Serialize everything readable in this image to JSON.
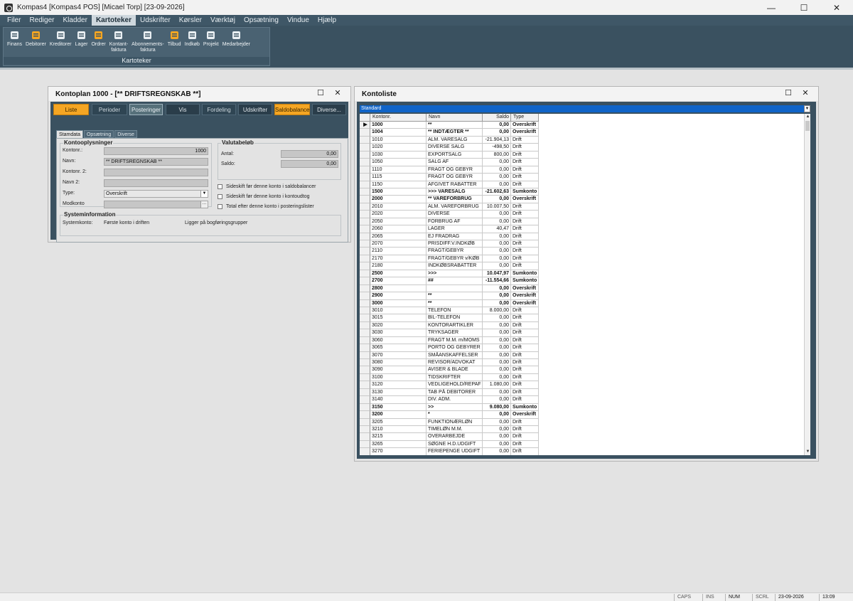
{
  "titlebar": {
    "title": "Kompas4  [Kompas4 POS]  [Micael Torp]  [23-09-2026]",
    "min": "—",
    "max": "☐",
    "close": "✕"
  },
  "menu": [
    "Filer",
    "Rediger",
    "Kladder",
    "Kartoteker",
    "Udskrifter",
    "Kørsler",
    "Værktøj",
    "Opsætning",
    "Vindue",
    "Hjælp"
  ],
  "ribbon": {
    "group_label": "Kartoteker",
    "items": [
      {
        "label": "Finans",
        "icon": "books-icon"
      },
      {
        "label": "Debitorer",
        "icon": "customer-icon"
      },
      {
        "label": "Kreditorer",
        "icon": "person-icon"
      },
      {
        "label": "Lager",
        "icon": "warehouse-icon"
      },
      {
        "label": "Ordrer",
        "icon": "money-bag-icon"
      },
      {
        "label": "Kontant-\nfaktura",
        "icon": "cash-register-icon"
      },
      {
        "label": "Abonnements-\nfaktura",
        "icon": "refresh-icon"
      },
      {
        "label": "Tilbud",
        "icon": "edit-doc-icon"
      },
      {
        "label": "Indkøb",
        "icon": "purchase-icon"
      },
      {
        "label": "Projekt",
        "icon": "project-icon"
      },
      {
        "label": "Medarbejder",
        "icon": "id-card-icon"
      }
    ]
  },
  "kontoplan": {
    "title": "Kontoplan  1000 - [** DRIFTSREGNSKAB **]",
    "buttons": [
      "Liste",
      "Perioder",
      "Posteringer",
      "Vis",
      "Fordeling",
      "Udskrifter",
      "Saldobalance",
      "Diverse..."
    ],
    "tabs": [
      "Stamdata",
      "Opsætning",
      "Diverse"
    ],
    "kontooplysninger": {
      "title": "Kontooplysninger",
      "kontonr_label": "Kontonr.:",
      "kontonr": "1000",
      "navn_label": "Navn:",
      "navn": "** DRIFTSREGNSKAB **",
      "kontonr2_label": "Kontonr. 2:",
      "navn2_label": "Navn 2:",
      "type_label": "Type:",
      "type": "Overskrift",
      "modkonto_label": "Modkonto"
    },
    "valuta": {
      "title": "Valutabeløb",
      "antal_label": "Antal:",
      "antal": "0,00",
      "saldo_label": "Saldo:",
      "saldo": "0,00"
    },
    "checks": [
      "Sideskift før denne konto i saldobalancer",
      "Sideskift før denne konto i kontoudtog",
      "Total efter denne konto i posteringslister"
    ],
    "system": {
      "title": "Systeminformation",
      "label": "Systemkonto:",
      "value": "Første konto i driften",
      "note": "Ligger på bogføringsgrupper"
    }
  },
  "kontoliste": {
    "title": "Kontoliste",
    "filter": "Standard",
    "headers": [
      "Kontonr.",
      "Navn",
      "Saldo",
      "Type"
    ],
    "rows": [
      {
        "k": "1000",
        "n": "**",
        "s": "0,00",
        "t": "Overskrift",
        "b": true,
        "sel": true
      },
      {
        "k": "1004",
        "n": "** INDTÆGTER **",
        "s": "0,00",
        "t": "Overskrift",
        "b": true
      },
      {
        "k": "1010",
        "n": "ALM. VARESALG",
        "s": "-21.904,13",
        "t": "Drift"
      },
      {
        "k": "1020",
        "n": "DIVERSE SALG",
        "s": "-498,50",
        "t": "Drift"
      },
      {
        "k": "1030",
        "n": "EXPORTSALG",
        "s": "800,00",
        "t": "Drift"
      },
      {
        "k": "1050",
        "n": "SALG AF",
        "s": "0,00",
        "t": "Drift"
      },
      {
        "k": "1110",
        "n": "FRAGT OG GEBYR",
        "s": "0,00",
        "t": "Drift"
      },
      {
        "k": "1115",
        "n": "FRAGT OG GEBYR",
        "s": "0,00",
        "t": "Drift"
      },
      {
        "k": "1150",
        "n": "AFGIVET RABATTER",
        "s": "0,00",
        "t": "Drift"
      },
      {
        "k": "1500",
        "n": ">>> VARESALG",
        "s": "-21.602,63",
        "t": "Sumkonto",
        "b": true
      },
      {
        "k": "2000",
        "n": "** VAREFORBRUG",
        "s": "0,00",
        "t": "Overskrift",
        "b": true
      },
      {
        "k": "2010",
        "n": "ALM. VAREFORBRUG",
        "s": "10.007,50",
        "t": "Drift"
      },
      {
        "k": "2020",
        "n": "DIVERSE",
        "s": "0,00",
        "t": "Drift"
      },
      {
        "k": "2050",
        "n": "FORBRUG AF",
        "s": "0,00",
        "t": "Drift"
      },
      {
        "k": "2060",
        "n": "LAGER",
        "s": "40,47",
        "t": "Drift"
      },
      {
        "k": "2065",
        "n": "EJ FRADRAG",
        "s": "0,00",
        "t": "Drift"
      },
      {
        "k": "2070",
        "n": "PRISDIFF.V.INDKØB",
        "s": "0,00",
        "t": "Drift"
      },
      {
        "k": "2110",
        "n": "FRAGT/GEBYR",
        "s": "0,00",
        "t": "Drift"
      },
      {
        "k": "2170",
        "n": "FRAGT/GEBYR v/KØB",
        "s": "0,00",
        "t": "Drift"
      },
      {
        "k": "2180",
        "n": "INDKØBSRABATTER",
        "s": "0,00",
        "t": "Drift"
      },
      {
        "k": "2500",
        "n": ">>>",
        "s": "10.047,97",
        "t": "Sumkonto",
        "b": true
      },
      {
        "k": "2700",
        "n": "##",
        "s": "-11.554,66",
        "t": "Sumkonto",
        "b": true
      },
      {
        "k": "2800",
        "n": "",
        "s": "0,00",
        "t": "Overskrift",
        "b": true
      },
      {
        "k": "2900",
        "n": "**",
        "s": "0,00",
        "t": "Overskrift",
        "b": true
      },
      {
        "k": "3000",
        "n": "**",
        "s": "0,00",
        "t": "Overskrift",
        "b": true
      },
      {
        "k": "3010",
        "n": "TELEFON",
        "s": "8.000,00",
        "t": "Drift"
      },
      {
        "k": "3015",
        "n": "BIL-TELEFON",
        "s": "0,00",
        "t": "Drift"
      },
      {
        "k": "3020",
        "n": "KONTORARTIKLER",
        "s": "0,00",
        "t": "Drift"
      },
      {
        "k": "3030",
        "n": "TRYKSAGER",
        "s": "0,00",
        "t": "Drift"
      },
      {
        "k": "3060",
        "n": "FRAGT M.M. m/MOMS",
        "s": "0,00",
        "t": "Drift"
      },
      {
        "k": "3065",
        "n": "PORTO OG GEBYRER",
        "s": "0,00",
        "t": "Drift"
      },
      {
        "k": "3070",
        "n": "SMÅANSKAFFELSER",
        "s": "0,00",
        "t": "Drift"
      },
      {
        "k": "3080",
        "n": "REVISOR/ADVOKAT",
        "s": "0,00",
        "t": "Drift"
      },
      {
        "k": "3090",
        "n": "AVISER & BLADE",
        "s": "0,00",
        "t": "Drift"
      },
      {
        "k": "3100",
        "n": "TIDSKRIFTER",
        "s": "0,00",
        "t": "Drift"
      },
      {
        "k": "3120",
        "n": "VEDLIGEHOLD/REPAF",
        "s": "1.080,00",
        "t": "Drift"
      },
      {
        "k": "3130",
        "n": "TAB PÅ DEBITORER",
        "s": "0,00",
        "t": "Drift"
      },
      {
        "k": "3140",
        "n": "DIV. ADM.",
        "s": "0,00",
        "t": "Drift"
      },
      {
        "k": "3150",
        "n": ">>",
        "s": "9.080,00",
        "t": "Sumkonto",
        "b": true
      },
      {
        "k": "3200",
        "n": "*",
        "s": "0,00",
        "t": "Overskrift",
        "b": true
      },
      {
        "k": "3205",
        "n": "FUNKTIONÆRLØN",
        "s": "0,00",
        "t": "Drift"
      },
      {
        "k": "3210",
        "n": "TIMELØN M.M.",
        "s": "0,00",
        "t": "Drift"
      },
      {
        "k": "3215",
        "n": "OVERARBEJDE",
        "s": "0,00",
        "t": "Drift"
      },
      {
        "k": "3265",
        "n": "SØGNE H.D.UDGIFT",
        "s": "0,00",
        "t": "Drift"
      },
      {
        "k": "3270",
        "n": "FERIEPENGE UDGIFT",
        "s": "0,00",
        "t": "Drift"
      }
    ]
  },
  "status": {
    "caps": "CAPS",
    "ins": "INS",
    "num": "NUM",
    "scrl": "SCRL",
    "date": "23-09-2026",
    "time": "13:09"
  },
  "colors": {
    "accent": "#f5a623",
    "chrome": "#3a5160",
    "selection": "#1064c8"
  }
}
